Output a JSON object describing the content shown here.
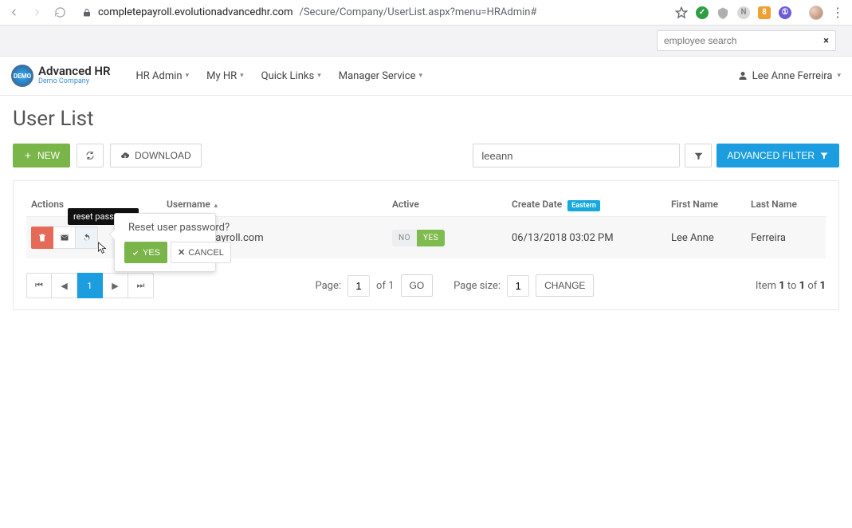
{
  "browser": {
    "host": "completepayroll.evolutionadvancedhr.com",
    "path": "/Secure/Company/UserList.aspx?menu=HRAdmin#"
  },
  "top_search": {
    "placeholder": "employee search"
  },
  "brand": {
    "title": "Advanced HR",
    "subtitle": "Demo Company",
    "badge": "DEMO"
  },
  "nav": {
    "items": [
      "HR Admin",
      "My HR",
      "Quick Links",
      "Manager Service"
    ]
  },
  "user": {
    "name": "Lee Anne Ferreira"
  },
  "page_title": "User List",
  "toolbar": {
    "new_label": "NEW",
    "download_label": "DOWNLOAD",
    "search_value": "leeann",
    "advanced_filter_label": "ADVANCED FILTER"
  },
  "table": {
    "headers": {
      "actions": "Actions",
      "username": "Username",
      "active": "Active",
      "create_date": "Create Date",
      "tz_badge": "Eastern",
      "first_name": "First Name",
      "last_name": "Last Name"
    },
    "row": {
      "username": "completepayroll.com",
      "active_no": "NO",
      "active_yes": "YES",
      "create_date": "06/13/2018 03:02 PM",
      "first_name": "Lee Anne",
      "last_name": "Ferreira"
    }
  },
  "tooltip_text": "reset password",
  "popover": {
    "title": "Reset user password?",
    "yes": "YES",
    "cancel": "CANCEL"
  },
  "pager": {
    "page_label": "Page:",
    "page_value": "1",
    "of_label": "of 1",
    "go_label": "GO",
    "size_label": "Page size:",
    "size_value": "1",
    "change_label": "CHANGE",
    "summary_prefix": "Item ",
    "summary_from": "1",
    "summary_to_word": " to ",
    "summary_to": "1",
    "summary_of_word": " of ",
    "summary_total": "1"
  }
}
